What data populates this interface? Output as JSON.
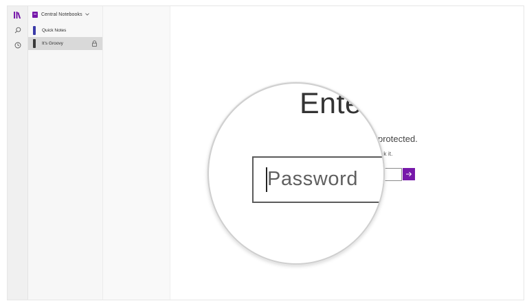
{
  "rail": {
    "items": [
      {
        "icon": "notebooks-icon"
      },
      {
        "icon": "search-icon"
      },
      {
        "icon": "recent-icon"
      }
    ]
  },
  "notebook": {
    "name": "Central Notebooks",
    "color": "#7719aa"
  },
  "sections": [
    {
      "label": "Quick Notes",
      "color": "#3b3ba8",
      "selected": false
    },
    {
      "label": "It's Groovy",
      "color": "#3a3a3a",
      "selected": true,
      "locked": true
    }
  ],
  "content": {
    "heading": "Ente",
    "description": "protected.",
    "hint": "ck it.",
    "password_placeholder": "Password",
    "accent_color": "#7719aa"
  }
}
